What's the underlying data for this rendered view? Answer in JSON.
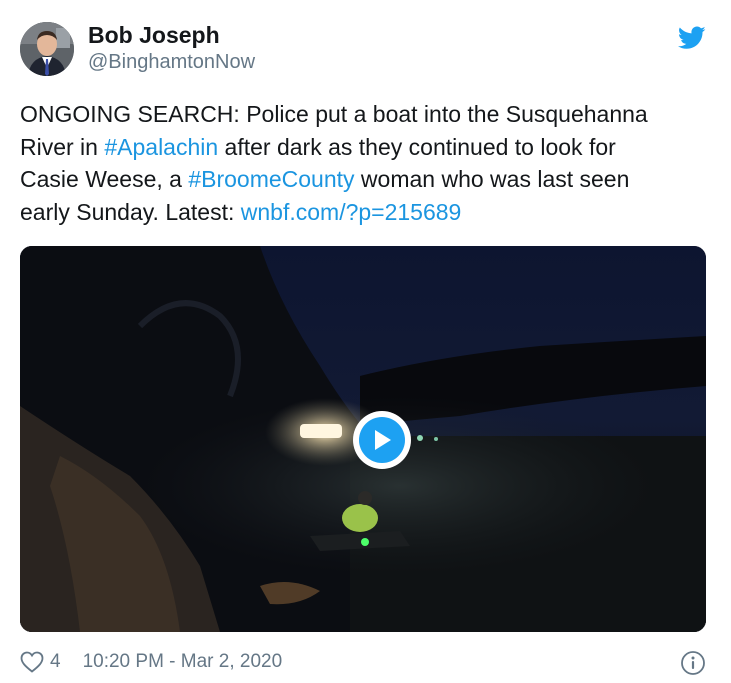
{
  "author": {
    "name": "Bob Joseph",
    "handle": "@BinghamtonNow",
    "avatar_icon": "profile-photo"
  },
  "brand": {
    "icon": "twitter-bird-icon",
    "color": "#1da1f2"
  },
  "tweet": {
    "line1": "ONGOING SEARCH: Police put a boat into the Susquehanna",
    "line2_pre": "River in ",
    "hashtag1": "#Apalachin",
    "line2_post": " after dark as they continued to look for",
    "line3_pre": "Casie Weese, a ",
    "hashtag2": "#BroomeCounty",
    "line3_post": " woman who was last seen",
    "line4_pre": "early Sunday. Latest: ",
    "url": "wnbf.com/?p=215689"
  },
  "media": {
    "type": "video",
    "play_icon": "play-icon"
  },
  "footer": {
    "like_icon": "heart-icon",
    "like_count": "4",
    "timestamp": "10:20 PM - Mar 2, 2020",
    "info_icon": "info-icon"
  },
  "colors": {
    "link": "#1b95e0",
    "secondary_text": "#657786",
    "primary_text": "#14171a"
  }
}
